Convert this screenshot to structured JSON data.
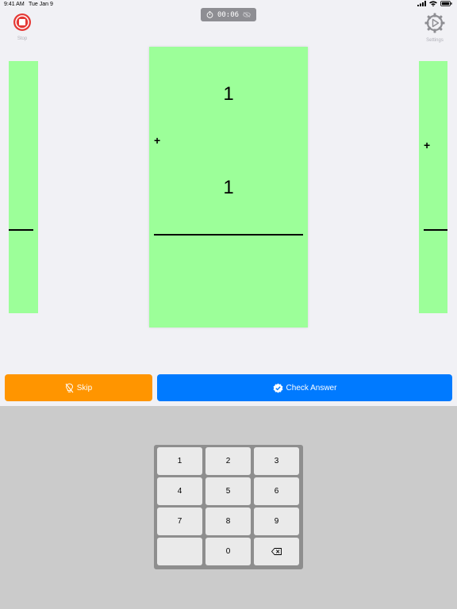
{
  "status_bar": {
    "time": "9:41 AM",
    "date": "Tue Jan 9"
  },
  "toolbar": {
    "stop_label": "Stop",
    "settings_label": "Settings",
    "timer": "00:06"
  },
  "cards": {
    "main": {
      "top_number": "1",
      "operator": "+",
      "bottom_number": "1"
    },
    "left": {},
    "right": {
      "operator": "+"
    }
  },
  "actions": {
    "skip_label": "Skip",
    "check_label": "Check Answer"
  },
  "keypad": {
    "keys": [
      "1",
      "2",
      "3",
      "4",
      "5",
      "6",
      "7",
      "8",
      "9",
      "",
      "0"
    ],
    "backspace_icon": "backspace-icon"
  },
  "colors": {
    "card": "#9cff99",
    "skip": "#ff9500",
    "check": "#007aff",
    "stop": "#e53935",
    "keyboard_bg": "#cbcbcb"
  }
}
